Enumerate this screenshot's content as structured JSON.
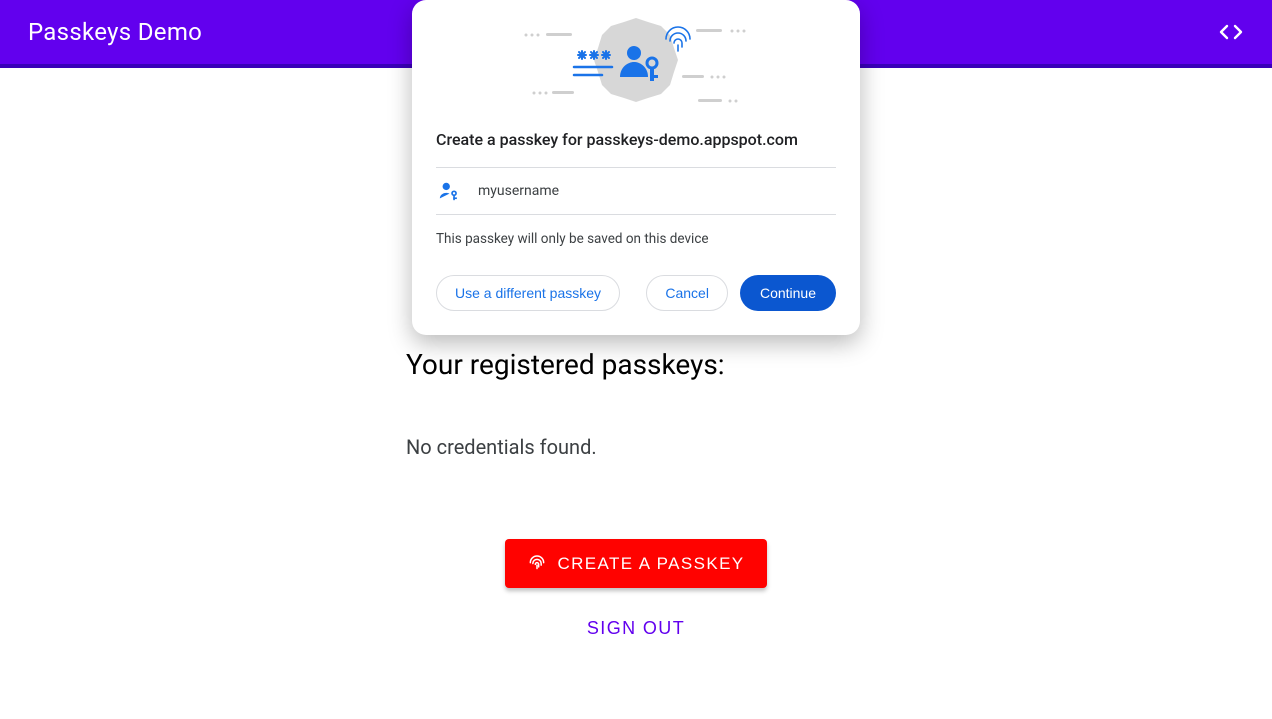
{
  "header": {
    "title": "Passkeys Demo"
  },
  "main": {
    "section_title": "Your registered passkeys:",
    "no_credentials": "No credentials found.",
    "create_button_label": "CREATE A PASSKEY",
    "signout_label": "SIGN OUT"
  },
  "modal": {
    "title": "Create a passkey for passkeys-demo.appspot.com",
    "username": "myusername",
    "note": "This passkey will only be saved on this device",
    "use_different_label": "Use a different passkey",
    "cancel_label": "Cancel",
    "continue_label": "Continue"
  },
  "colors": {
    "primary": "#6200ee",
    "accent_blue": "#1a73e8",
    "button_blue": "#0b57d0",
    "danger_red": "#ff0200"
  }
}
